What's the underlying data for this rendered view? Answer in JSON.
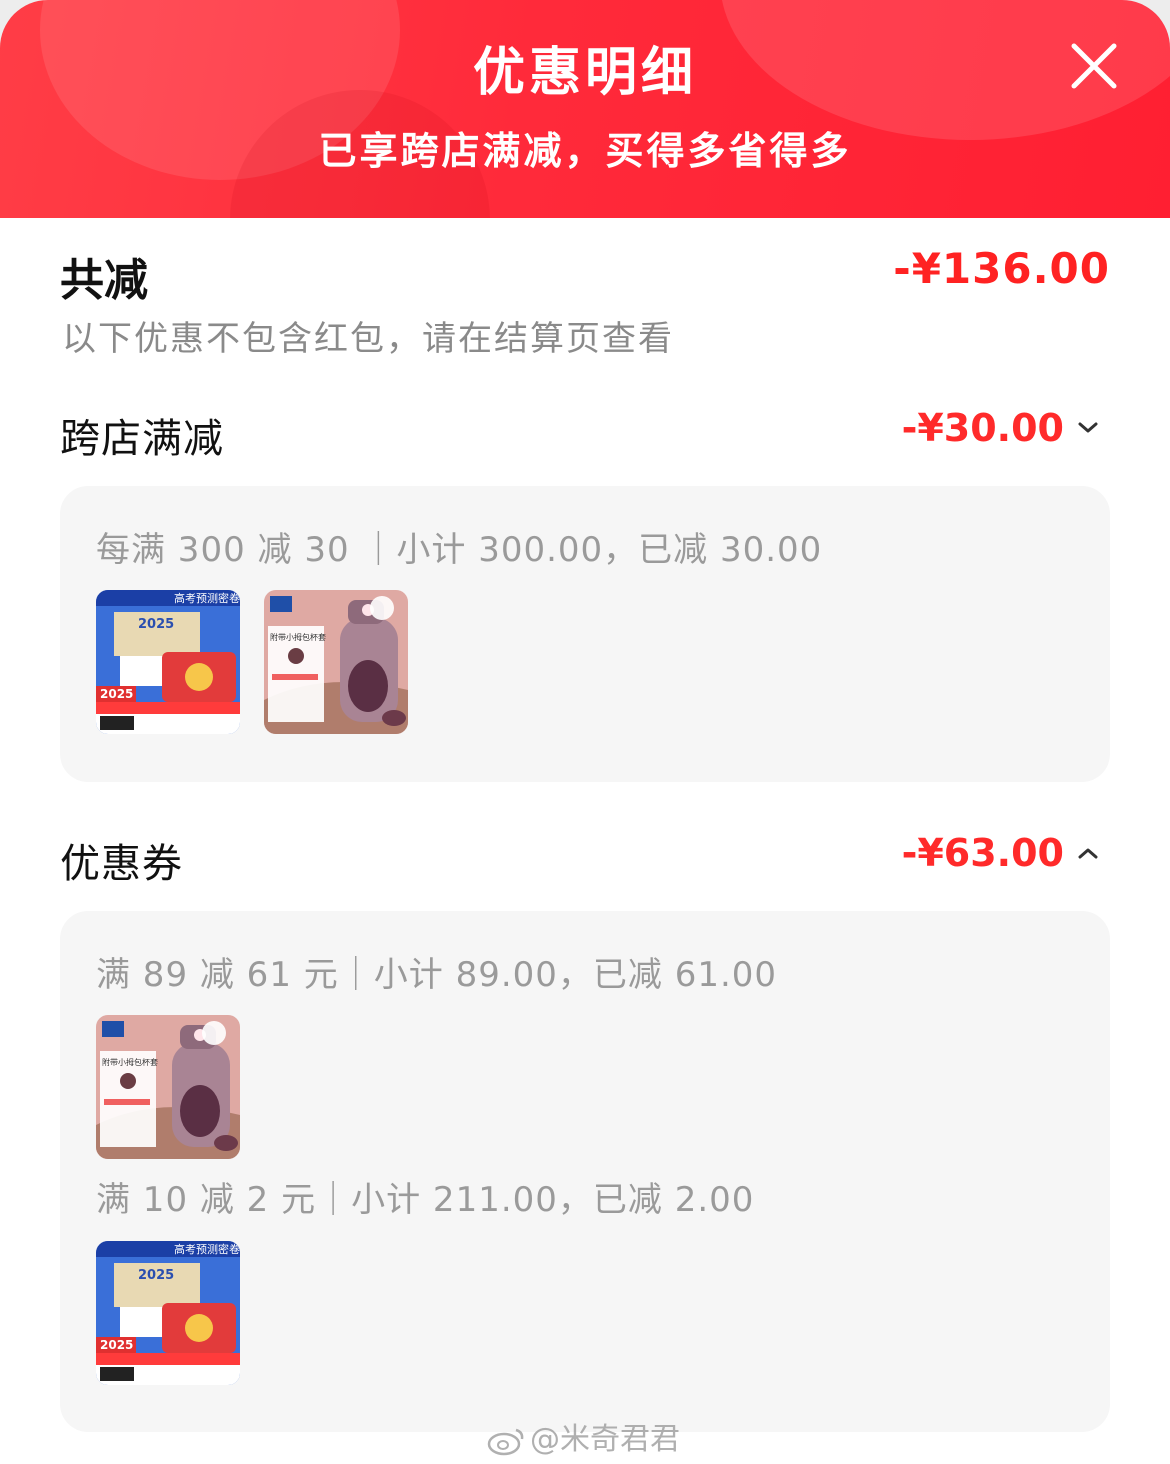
{
  "header": {
    "title": "优惠明细",
    "subtitle": "已享跨店满减，买得多省得多",
    "close_icon": "close-icon"
  },
  "summary": {
    "label": "共减",
    "amount": "-¥136.00",
    "note": "以下优惠不包含红包，请在结算页查看"
  },
  "cross_store": {
    "title": "跨店满减",
    "amount": "-¥30.00",
    "toggle_icon": "chevron-down-icon",
    "rule": "每满 300 减 30 ｜小计 300.00，已减 30.00",
    "products": [
      {
        "name": "exam-prep-book-thumbnail",
        "caption": "高考预测密卷",
        "year": "2025"
      },
      {
        "name": "kids-thermos-bottle-thumbnail",
        "caption": "附带小拇包杯套"
      }
    ]
  },
  "coupon": {
    "title": "优惠券",
    "amount": "-¥63.00",
    "toggle_icon": "chevron-up-icon",
    "groups": [
      {
        "rule": "满 89 减 61 元｜小计 89.00，已减 61.00",
        "products": [
          {
            "name": "kids-thermos-bottle-thumbnail",
            "caption": "附带小拇包杯套"
          }
        ]
      },
      {
        "rule": "满 10 减 2 元｜小计 211.00，已减 2.00",
        "products": [
          {
            "name": "exam-prep-book-thumbnail",
            "caption": "高考预测密卷",
            "year": "2025"
          }
        ]
      }
    ]
  },
  "watermark": "@米奇君君",
  "colors": {
    "header_red": "#ff2a3a",
    "amount_red": "#ff2222",
    "card_bg": "#f6f6f6"
  }
}
